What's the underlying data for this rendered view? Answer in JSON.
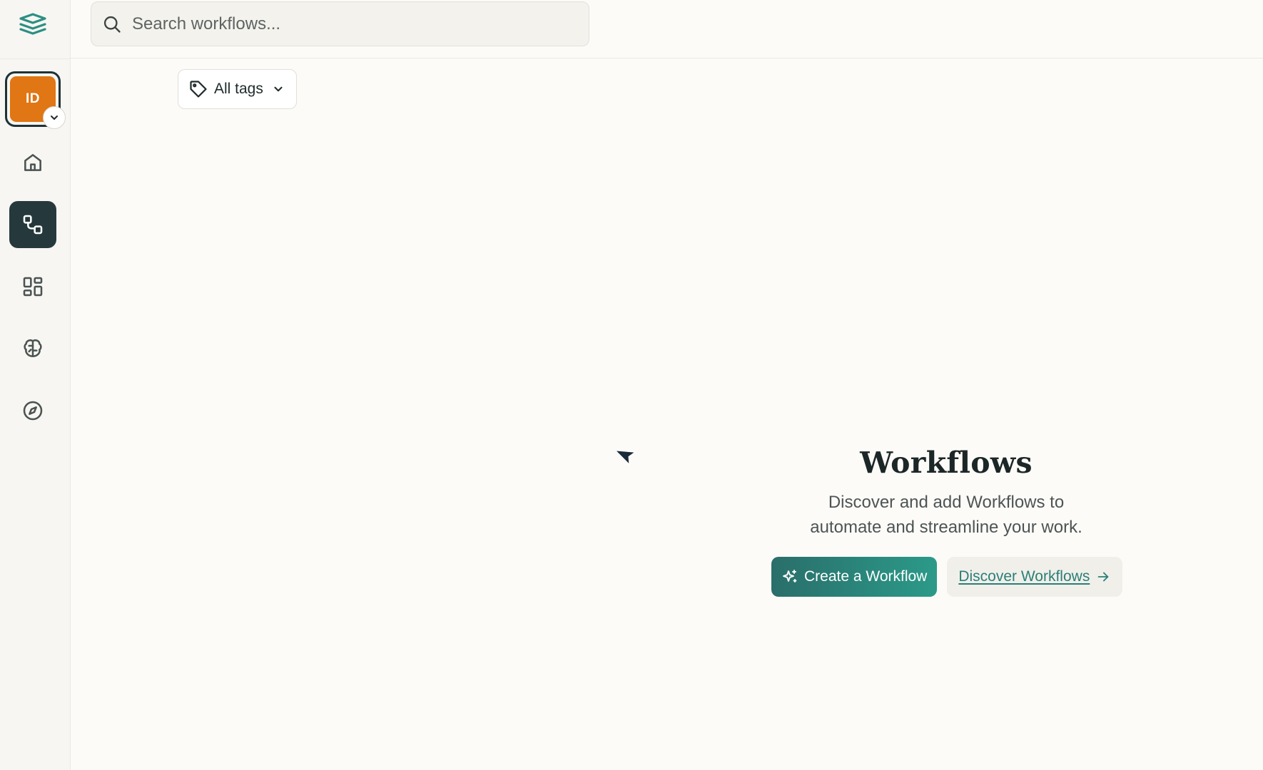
{
  "sidebar": {
    "logo_icon": "layers-logo-icon",
    "avatar": {
      "initials": "ID",
      "color": "#e07614"
    },
    "items": [
      {
        "icon": "home-icon",
        "active": false
      },
      {
        "icon": "workflow-icon",
        "active": true
      },
      {
        "icon": "apps-grid-icon",
        "active": false
      },
      {
        "icon": "brain-icon",
        "active": false
      },
      {
        "icon": "compass-icon",
        "active": false
      }
    ]
  },
  "search": {
    "placeholder": "Search workflows...",
    "value": ""
  },
  "filters": {
    "tags_label": "All tags"
  },
  "empty_state": {
    "title": "Workflows",
    "description": "Discover and add Workflows to automate and streamline your work.",
    "create_label": "Create a Workflow",
    "discover_label": "Discover Workflows"
  },
  "colors": {
    "accent": "#2b9a89",
    "sidebar_active": "#25393d",
    "avatar": "#e07614",
    "background": "#fcfbf8"
  }
}
